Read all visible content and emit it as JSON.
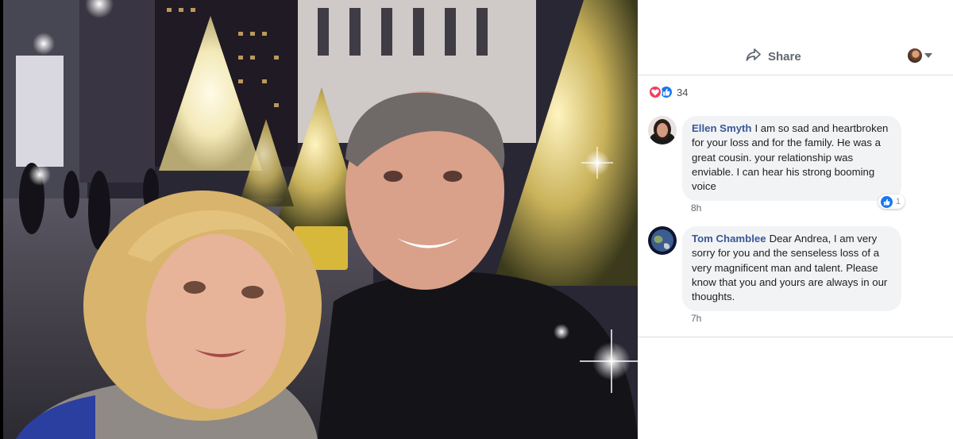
{
  "post": {
    "photo": {
      "icon": "selfie-photo"
    },
    "share_label": "Share",
    "icons": {
      "share": "share-arrow-icon",
      "menu": "chevron-down-icon"
    }
  },
  "reactions": {
    "count": "34",
    "types": [
      "love",
      "like"
    ],
    "colors": {
      "love": "#f33e58",
      "like": "#1877f2"
    }
  },
  "comments": [
    {
      "author": "Ellen Smyth",
      "text": "I am so sad and heartbroken for your loss and for the family. He was a great cousin. your relationship was enviable. I can hear his strong booming voice",
      "time": "8h",
      "likes": "1"
    },
    {
      "author": "Tom Chamblee",
      "text": "Dear Andrea, I am very sorry for you and the senseless loss of a very magnificent man and talent. Please know that you and yours are always in our thoughts.",
      "time": "7h"
    }
  ],
  "colors": {
    "author_link": "#385898",
    "bubble": "#f2f3f5",
    "meta": "#606770"
  }
}
